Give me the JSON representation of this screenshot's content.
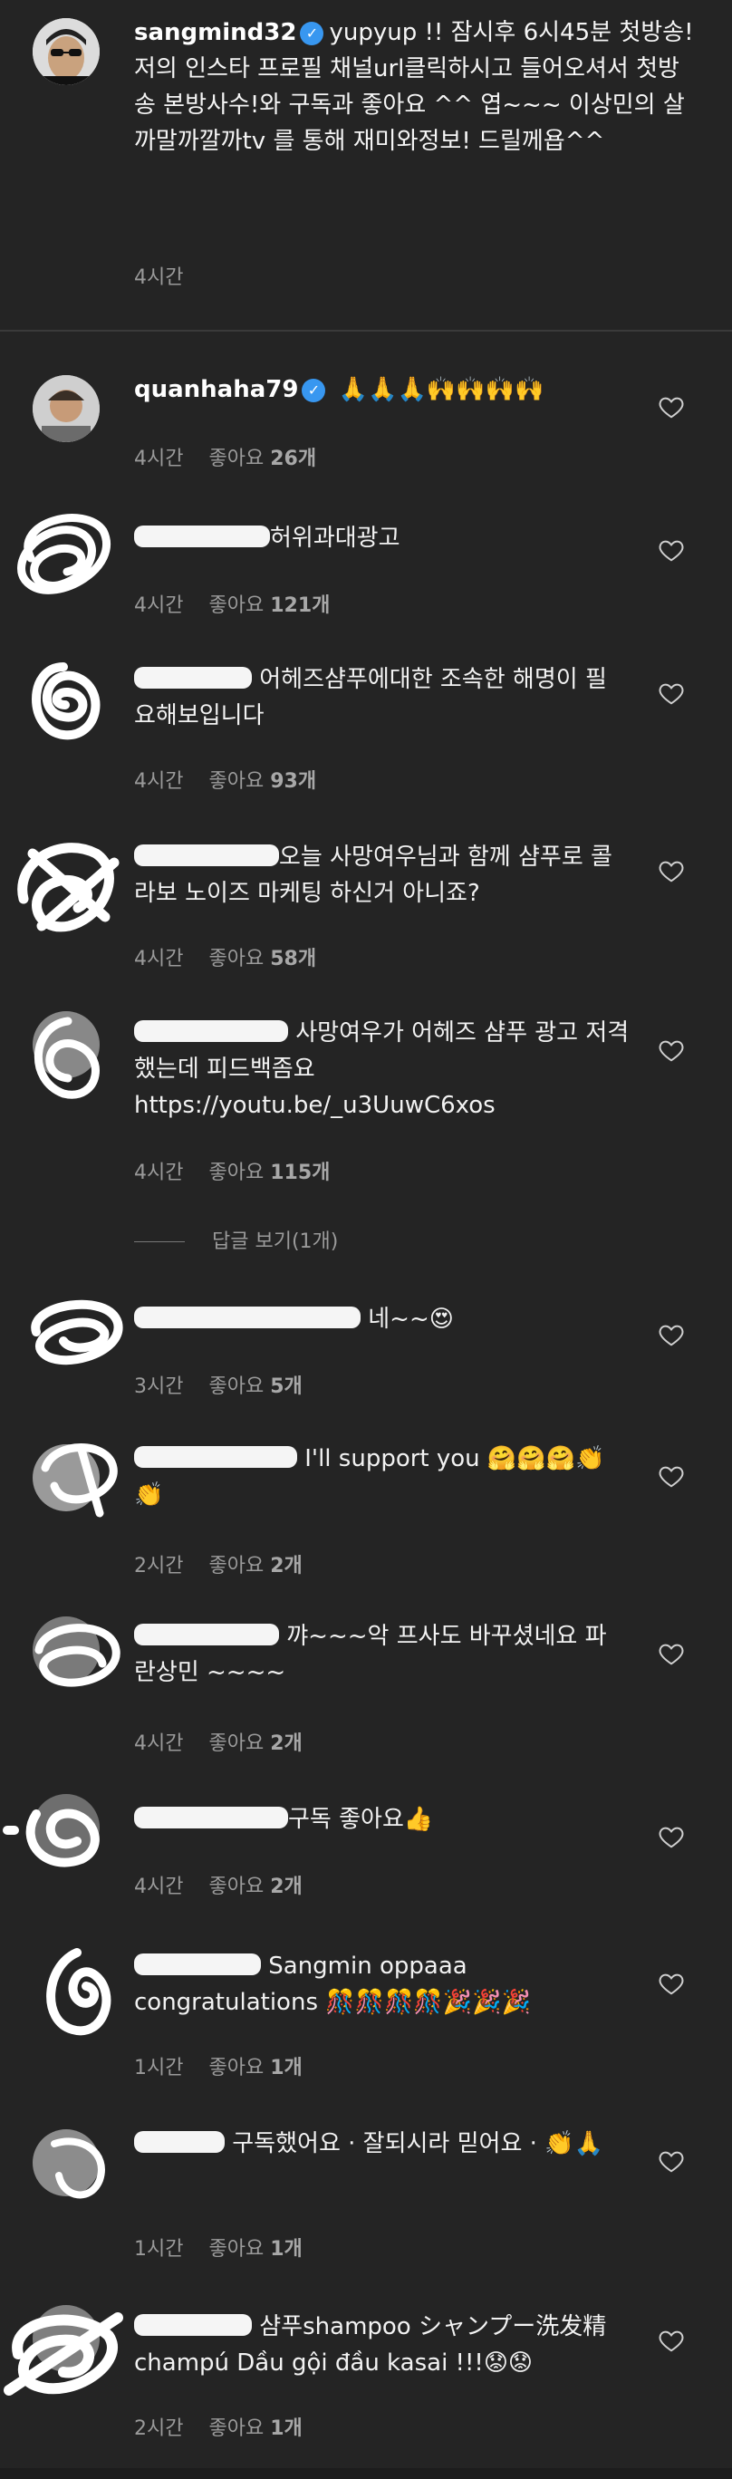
{
  "caption": {
    "username": "sangmind32",
    "text": "yupyup !! 잠시후 6시45분 첫방송! 저의 인스타 프로필 채널url클릭하시고 들어오셔서 첫방송 본방사수!와 구독과 좋아요 ^^ 엽~~~ 이상민의 살까말까깔까tv 를 통해 재미와정보! 드릴께욥^^",
    "time": "4시간"
  },
  "like_label": "좋아요",
  "comments": [
    {
      "username": "quanhaha79",
      "text": "🙏🙏🙏🙌🙌🙌🙌",
      "time": "4시간",
      "likes": "26개"
    },
    {
      "username": "",
      "text": "허위과대광고",
      "time": "4시간",
      "likes": "121개"
    },
    {
      "username": "",
      "text": "어헤즈샴푸에대한 조속한 해명이 필요해보입니다",
      "time": "4시간",
      "likes": "93개"
    },
    {
      "username": "",
      "text": "오늘 사망여우님과 함께 샴푸로 콜라보 노이즈 마케팅 하신거 아니죠?",
      "time": "4시간",
      "likes": "58개"
    },
    {
      "username": "",
      "text": "사망여우가 어헤즈 샴푸 광고 저격했는데 피드백좀요 https://youtu.be/_u3UuwC6xos",
      "time": "4시간",
      "likes": "115개"
    },
    {
      "username": "",
      "text": "네~~😍",
      "time": "3시간",
      "likes": "5개"
    },
    {
      "username": "",
      "text": "I'll support you 🤗🤗🤗👏👏",
      "time": "2시간",
      "likes": "2개"
    },
    {
      "username": "",
      "text": "꺄~~~악 프사도 바꾸셨네요 파란상민 ~~~~",
      "time": "4시간",
      "likes": "2개"
    },
    {
      "username": "",
      "text": "구독 좋아요👍",
      "time": "4시간",
      "likes": "2개"
    },
    {
      "username": "",
      "text": "Sangmin oppaaa congratulations 🎊🎊🎊🎊🎉🎉🎉",
      "time": "1시간",
      "likes": "1개"
    },
    {
      "username": "",
      "text": "구독했어요 · 잘되시라 믿어요 · 👏🙏",
      "time": "1시간",
      "likes": "1개"
    },
    {
      "username": "",
      "text": "샴푸shampoo シャンプー洗发精champú Dầu gội đầu kasai !!!😟😟",
      "time": "2시간",
      "likes": "1개"
    }
  ],
  "view_replies": "답글 보기(1개)",
  "colors": {
    "background": "#242424",
    "verified": "#3897f0",
    "muted": "#9a9a9a"
  }
}
